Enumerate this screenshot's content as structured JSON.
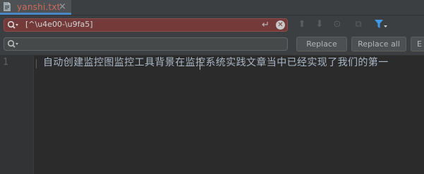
{
  "tab": {
    "title": "yanshi.txt",
    "close": "×"
  },
  "search": {
    "value": "[^\\u4e00-\\u9fa5]",
    "enter_glyph": "↵",
    "clear_glyph": "✕"
  },
  "toolbar": {
    "prev_glyph": "⬆",
    "next_glyph": "⬇",
    "find_all_glyph": "⊙",
    "select_all_glyph": "⧉"
  },
  "replace": {
    "value": "",
    "replace_label": "Replace",
    "replace_all_label": "Replace all",
    "exclude_label": "E"
  },
  "editor": {
    "line_number": "1",
    "line_text": "自动创建监控图监控工具背景在监控系统实践文章当中已经实现了我们的第一"
  },
  "colors": {
    "tab_title": "#d0695a",
    "search_error_bg": "#743a3a",
    "accent": "#4a88c7",
    "editor_bg": "#2b2b2b"
  },
  "icons": [
    "file-icon",
    "close-icon",
    "search-icon",
    "enter-icon",
    "clear-icon",
    "arrow-up-icon",
    "arrow-down-icon",
    "find-all-icon",
    "select-all-icon",
    "filter-icon"
  ]
}
